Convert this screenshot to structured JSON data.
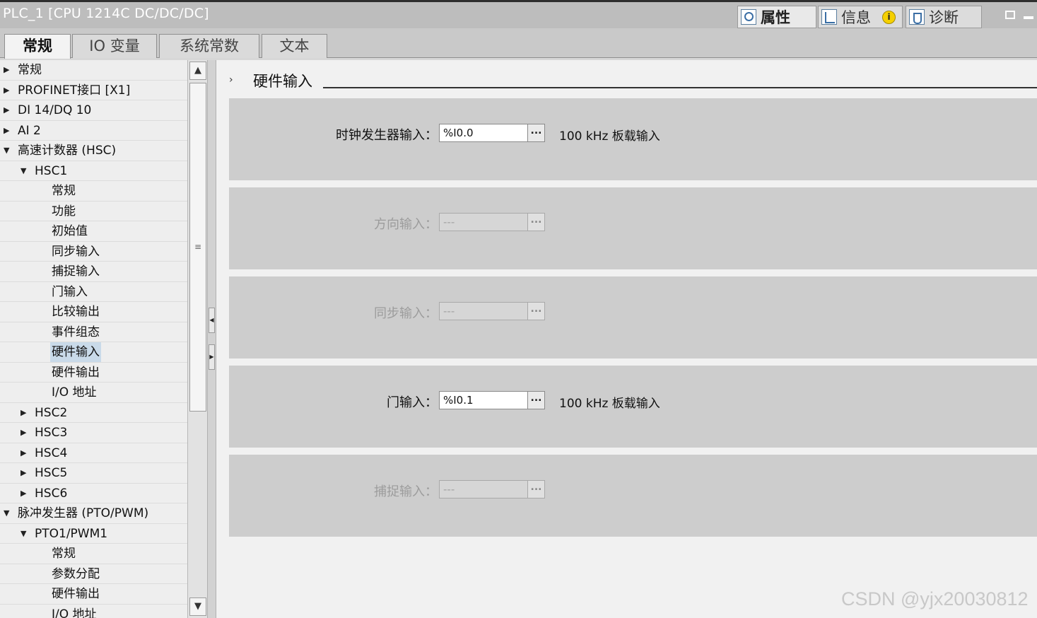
{
  "window": {
    "title": "PLC_1 [CPU 1214C DC/DC/DC]",
    "panel_tabs": [
      {
        "label": "属性",
        "icon": "properties-icon"
      },
      {
        "label": "信息",
        "icon": "info-icon"
      },
      {
        "label": "诊断",
        "icon": "diagnostics-icon"
      }
    ],
    "info_badge": "i"
  },
  "tabs": [
    "常规",
    "IO 变量",
    "系统常数",
    "文本"
  ],
  "tree": {
    "items": [
      {
        "label": "常规",
        "arrow": "▶"
      },
      {
        "label": "PROFINET接口 [X1]",
        "arrow": "▶"
      },
      {
        "label": "DI 14/DQ 10",
        "arrow": "▶"
      },
      {
        "label": "AI 2",
        "arrow": "▶"
      },
      {
        "label": "高速计数器 (HSC)",
        "arrow": "▼"
      },
      {
        "label": "HSC1",
        "arrow": "▼"
      },
      {
        "label": "常规",
        "arrow": ""
      },
      {
        "label": "功能",
        "arrow": ""
      },
      {
        "label": "初始值",
        "arrow": ""
      },
      {
        "label": "同步输入",
        "arrow": ""
      },
      {
        "label": "捕捉输入",
        "arrow": ""
      },
      {
        "label": "门输入",
        "arrow": ""
      },
      {
        "label": "比较输出",
        "arrow": ""
      },
      {
        "label": "事件组态",
        "arrow": ""
      },
      {
        "label": "硬件输入",
        "arrow": ""
      },
      {
        "label": "硬件输出",
        "arrow": ""
      },
      {
        "label": "I/O 地址",
        "arrow": ""
      },
      {
        "label": "HSC2",
        "arrow": "▶"
      },
      {
        "label": "HSC3",
        "arrow": "▶"
      },
      {
        "label": "HSC4",
        "arrow": "▶"
      },
      {
        "label": "HSC5",
        "arrow": "▶"
      },
      {
        "label": "HSC6",
        "arrow": "▶"
      },
      {
        "label": "脉冲发生器 (PTO/PWM)",
        "arrow": "▼"
      },
      {
        "label": "PTO1/PWM1",
        "arrow": "▼"
      },
      {
        "label": "常规",
        "arrow": ""
      },
      {
        "label": "参数分配",
        "arrow": ""
      },
      {
        "label": "硬件输出",
        "arrow": ""
      },
      {
        "label": "I/O 地址",
        "arrow": ""
      }
    ],
    "selected": "硬件输入"
  },
  "scrollbar": {
    "up": "▲",
    "down": "▼",
    "grip": "≡"
  },
  "splitter": {
    "left": "◀",
    "right": "▶"
  },
  "section": {
    "arrow": "›",
    "title": "硬件输入"
  },
  "fields": [
    {
      "label": "时钟发生器输入：",
      "value": "%I0.0",
      "note": "100 kHz 板载输入",
      "enabled": true
    },
    {
      "label": "方向输入：",
      "value": "---",
      "note": "",
      "enabled": false
    },
    {
      "label": "同步输入：",
      "value": "---",
      "note": "",
      "enabled": false
    },
    {
      "label": "门输入：",
      "value": "%I0.1",
      "note": "100 kHz 板载输入",
      "enabled": true
    },
    {
      "label": "捕捉输入：",
      "value": "---",
      "note": "",
      "enabled": false
    }
  ],
  "browse_label": "...",
  "watermark": "CSDN @yjx20030812"
}
